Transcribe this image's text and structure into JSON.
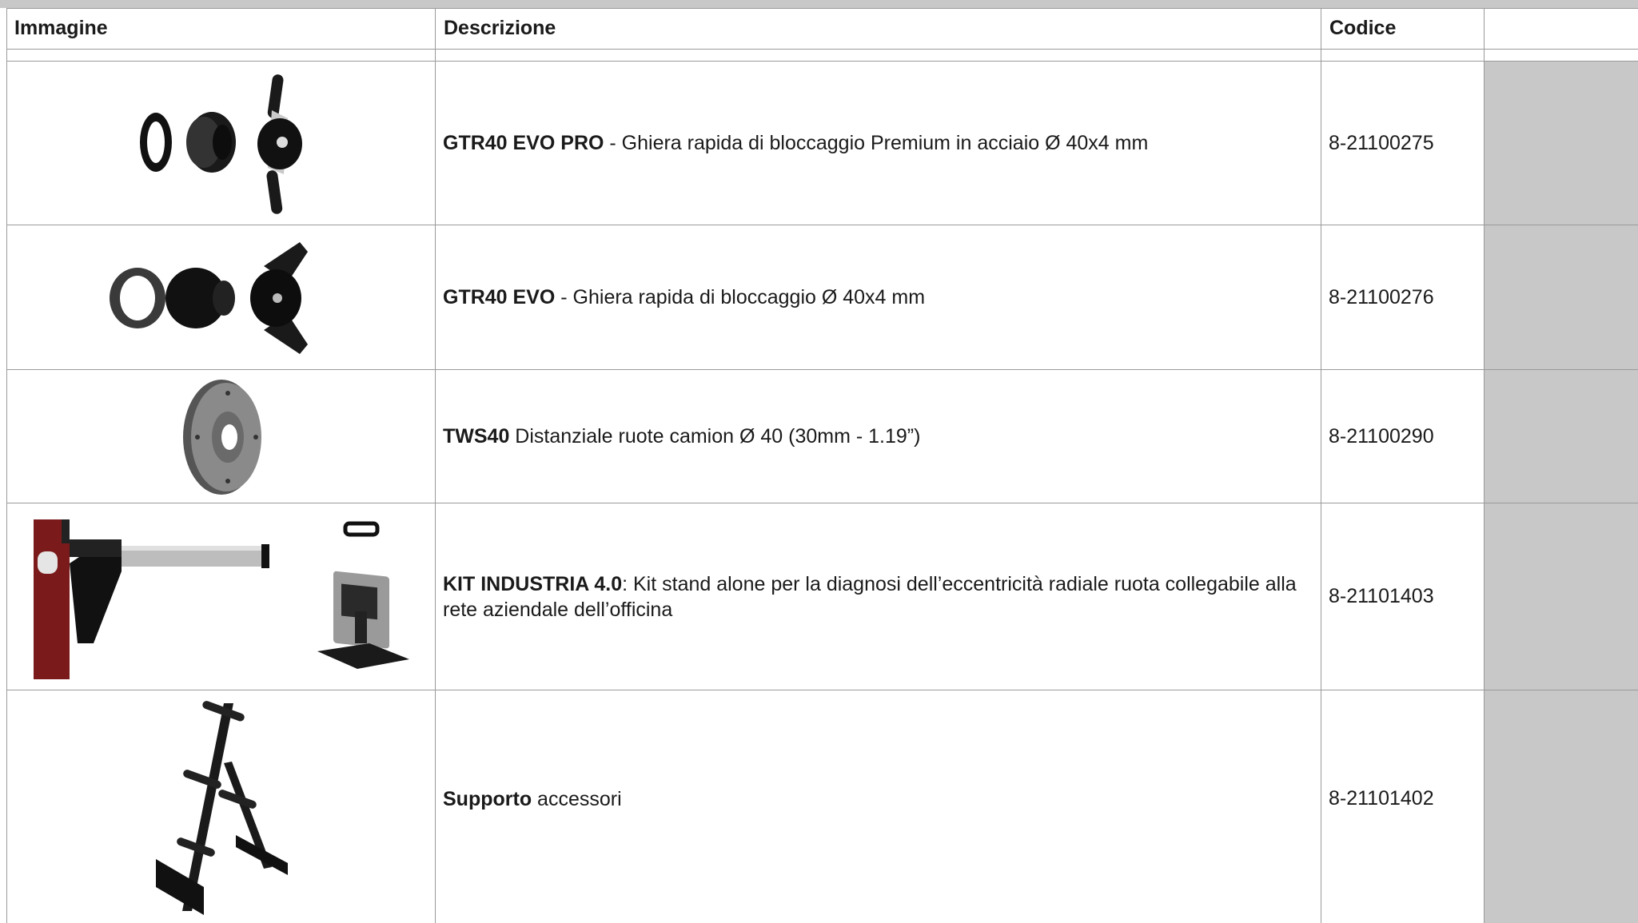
{
  "table": {
    "headers": {
      "image": "Immagine",
      "description": "Descrizione",
      "code": "Codice",
      "extra": ""
    },
    "rows": [
      {
        "name": "GTR40 EVO PRO",
        "description": " - Ghiera rapida di bloccaggio Premium in acciaio Ø 40x4 mm",
        "code": "8-21100275",
        "image_icon": "quick-lock-nut-premium-icon"
      },
      {
        "name": "GTR40 EVO",
        "description": " - Ghiera rapida di bloccaggio Ø 40x4 mm",
        "code": "8-21100276",
        "image_icon": "quick-lock-nut-icon"
      },
      {
        "name": "TWS40",
        "description": " Distanziale ruote camion Ø 40 (30mm - 1.19”)",
        "code": "8-21100290",
        "image_icon": "truck-wheel-spacer-icon"
      },
      {
        "name": "KIT INDUSTRIA 4.0",
        "description": ": Kit stand alone per la diagnosi dell’eccentricità radiale ruota collegabile alla rete aziendale dell’officina",
        "code": "8-21101403",
        "image_icon": "industry-kit-icon"
      },
      {
        "name": "Supporto",
        "description": " accessori",
        "code": "8-21101402",
        "image_icon": "accessory-stand-icon"
      }
    ]
  },
  "colors": {
    "border": "#9a9a9a",
    "gray_fill": "#c8c8c8",
    "kit_red": "#7a1a1a"
  }
}
